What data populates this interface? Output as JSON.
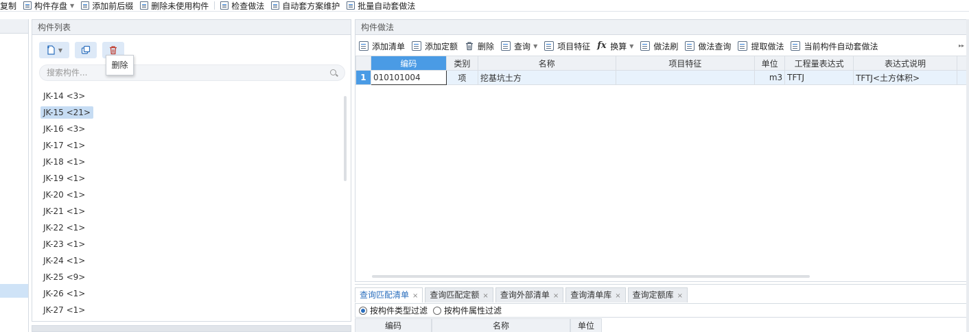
{
  "top_toolbar": {
    "items": [
      "复制",
      "构件存盘",
      "添加前后缀",
      "删除未使用构件",
      "检查做法",
      "自动套方案维护",
      "批量自动套做法"
    ]
  },
  "component_panel": {
    "title": "构件列表",
    "delete_tooltip": "删除",
    "search_placeholder": "搜索构件...",
    "items": [
      {
        "label": "JK-14 <3>",
        "selected": false
      },
      {
        "label": "JK-15 <21>",
        "selected": true
      },
      {
        "label": "JK-16 <3>",
        "selected": false
      },
      {
        "label": "JK-17 <1>",
        "selected": false
      },
      {
        "label": "JK-18 <1>",
        "selected": false
      },
      {
        "label": "JK-19 <1>",
        "selected": false
      },
      {
        "label": "JK-20 <1>",
        "selected": false
      },
      {
        "label": "JK-21 <1>",
        "selected": false
      },
      {
        "label": "JK-22 <1>",
        "selected": false
      },
      {
        "label": "JK-23 <1>",
        "selected": false
      },
      {
        "label": "JK-24 <1>",
        "selected": false
      },
      {
        "label": "JK-25 <9>",
        "selected": false
      },
      {
        "label": "JK-26 <1>",
        "selected": false
      },
      {
        "label": "JK-27 <1>",
        "selected": false
      }
    ]
  },
  "method_panel": {
    "title": "构件做法",
    "toolbar": {
      "add_list": "添加清单",
      "add_quota": "添加定额",
      "delete": "删除",
      "query": "查询",
      "item_feature": "项目特征",
      "convert": "换算",
      "method_brush": "做法刷",
      "method_query": "做法查询",
      "extract_method": "提取做法",
      "auto_apply": "当前构件自动套做法"
    },
    "columns": {
      "code": "编码",
      "category": "类别",
      "name": "名称",
      "feature": "项目特征",
      "unit": "单位",
      "expression": "工程量表达式",
      "expression_desc": "表达式说明"
    },
    "rows": [
      {
        "num": "1",
        "code": "010101004",
        "category": "项",
        "name": "挖基坑土方",
        "feature": "",
        "unit": "m3",
        "expression": "TFTJ",
        "expression_desc": "TFTJ<土方体积>"
      }
    ]
  },
  "bottom_panel": {
    "tabs": [
      "查询匹配清单",
      "查询匹配定额",
      "查询外部清单",
      "查询清单库",
      "查询定额库"
    ],
    "filters": {
      "by_type": "按构件类型过滤",
      "by_attr": "按构件属性过滤"
    },
    "columns": {
      "code": "编码",
      "name": "名称",
      "unit": "单位"
    }
  },
  "colors": {
    "accent": "#4a9be5",
    "selection": "#c6dcf3",
    "header_bg": "#eef1f5"
  }
}
